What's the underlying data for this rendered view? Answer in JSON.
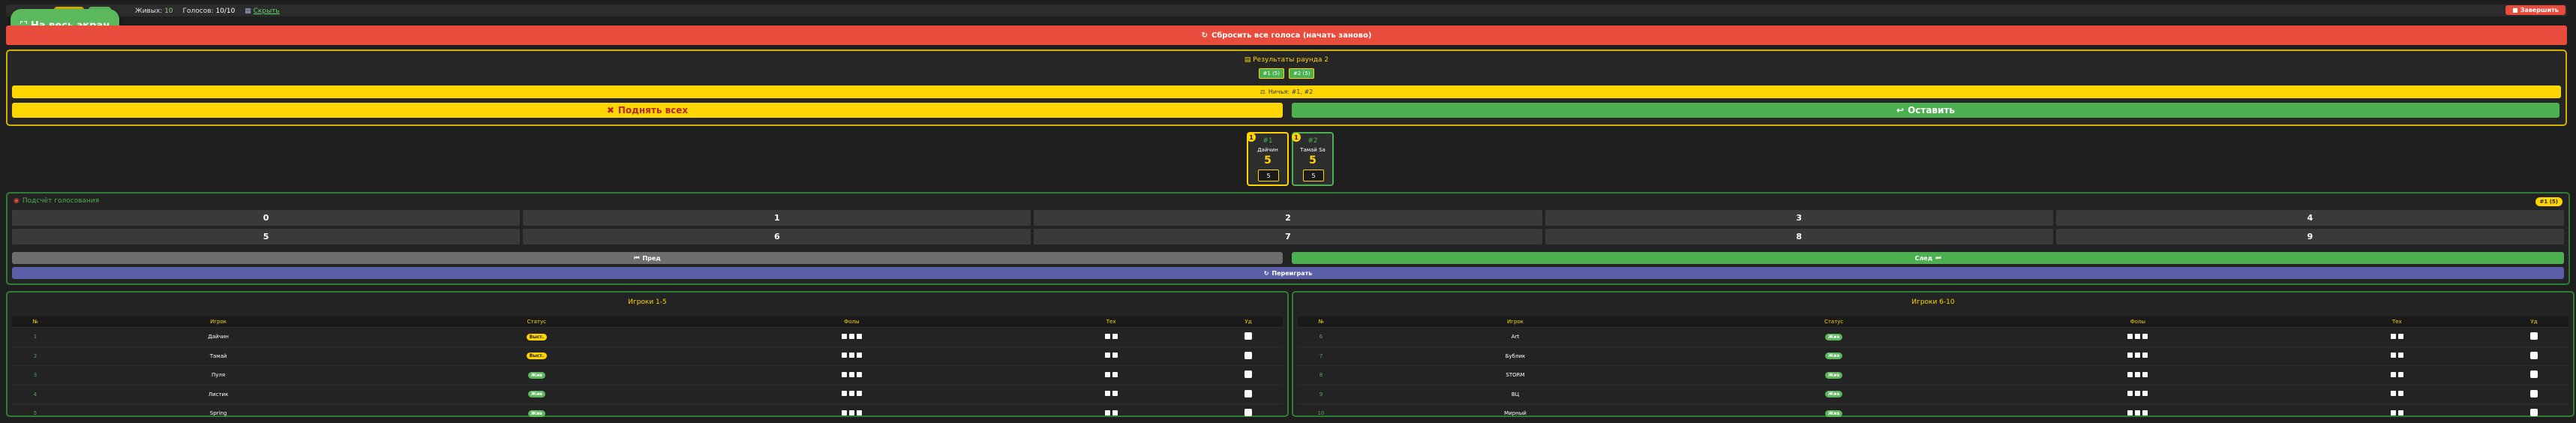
{
  "topbar": {
    "fullscreen_label": "На весь экран",
    "alive_label": "Живых:",
    "alive_value": "10",
    "votes_label": "Голосов:",
    "votes_value": "10/10",
    "link_label": "Скрыть",
    "finish_label": "Завершить"
  },
  "reset_label": "Сбросить все голоса (начать заново)",
  "results": {
    "title": "Результаты раунда 2",
    "tags": [
      "#1 (5)",
      "#2 (5)"
    ],
    "tie_text": "Ничья: #1, #2",
    "raise_label": "Поднять всех",
    "keep_label": "Оставить"
  },
  "candidates": [
    {
      "badge": "1",
      "num": "#1",
      "name": "Дайчин",
      "votes": "5",
      "input": "5"
    },
    {
      "badge": "1",
      "num": "#2",
      "name": "Тамай Sa",
      "votes": "5",
      "input": "5"
    }
  ],
  "voting": {
    "title": "Подсчёт голосования",
    "timer": "#1 (5)",
    "numbers": [
      "0",
      "1",
      "2",
      "3",
      "4",
      "5",
      "6",
      "7",
      "8",
      "9"
    ],
    "prev_label": "Пред",
    "next_label": "След",
    "repeat_label": "Переиграть"
  },
  "table_headers": [
    "№",
    "Игрок",
    "Статус",
    "Фолы",
    "Тех",
    "Уд"
  ],
  "panels": [
    {
      "title": "Игроки 1-5",
      "rows": [
        {
          "num": "1",
          "name": "Дайчин",
          "status": "Выст.",
          "status_color": "yellow"
        },
        {
          "num": "2",
          "name": "Тамай",
          "status": "Выст.",
          "status_color": "yellow"
        },
        {
          "num": "3",
          "name": "Пуля",
          "status": "Жив",
          "status_color": "green"
        },
        {
          "num": "4",
          "name": "Листик",
          "status": "Жив",
          "status_color": "green"
        },
        {
          "num": "5",
          "name": "Spring",
          "status": "Жив",
          "status_color": "green"
        }
      ]
    },
    {
      "title": "Игроки 6-10",
      "rows": [
        {
          "num": "6",
          "name": "Art",
          "status": "Жив",
          "status_color": "green"
        },
        {
          "num": "7",
          "name": "Бублик",
          "status": "Жив",
          "status_color": "green"
        },
        {
          "num": "8",
          "name": "STORM",
          "status": "Жив",
          "status_color": "green"
        },
        {
          "num": "9",
          "name": "ВЦ",
          "status": "Жив",
          "status_color": "green"
        },
        {
          "num": "10",
          "name": "Мирный",
          "status": "Жив",
          "status_color": "green"
        }
      ]
    }
  ],
  "colors": {
    "accent_yellow": "#ffd400",
    "accent_green": "#4caf50",
    "accent_red": "#e74c3c"
  }
}
